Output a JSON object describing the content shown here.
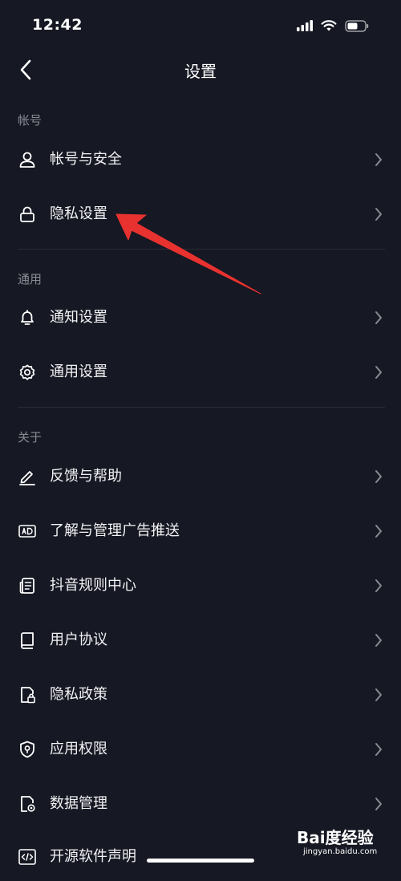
{
  "status_bar": {
    "time": "12:42"
  },
  "header": {
    "title": "设置"
  },
  "sections": [
    {
      "label": "帐号"
    },
    {
      "label": "通用"
    },
    {
      "label": "关于"
    }
  ],
  "items": [
    {
      "label": "帐号与安全",
      "icon": "user-icon"
    },
    {
      "label": "隐私设置",
      "icon": "lock-icon"
    },
    {
      "label": "通知设置",
      "icon": "bell-icon"
    },
    {
      "label": "通用设置",
      "icon": "gear-icon"
    },
    {
      "label": "反馈与帮助",
      "icon": "pen-icon"
    },
    {
      "label": "了解与管理广告推送",
      "icon": "ad-icon"
    },
    {
      "label": "抖音规则中心",
      "icon": "document-icon"
    },
    {
      "label": "用户协议",
      "icon": "book-icon"
    },
    {
      "label": "隐私政策",
      "icon": "file-lock-icon"
    },
    {
      "label": "应用权限",
      "icon": "shield-icon"
    },
    {
      "label": "数据管理",
      "icon": "file-settings-icon"
    },
    {
      "label": "开源软件声明",
      "icon": "code-icon"
    }
  ],
  "watermark": {
    "brand": "Bai度经验",
    "site": "jingyan.baidu.com"
  },
  "colors": {
    "background": "#161823",
    "divider": "#2a2c36",
    "annotation_arrow": "#e8322f",
    "muted_text": "#8a8b92"
  }
}
